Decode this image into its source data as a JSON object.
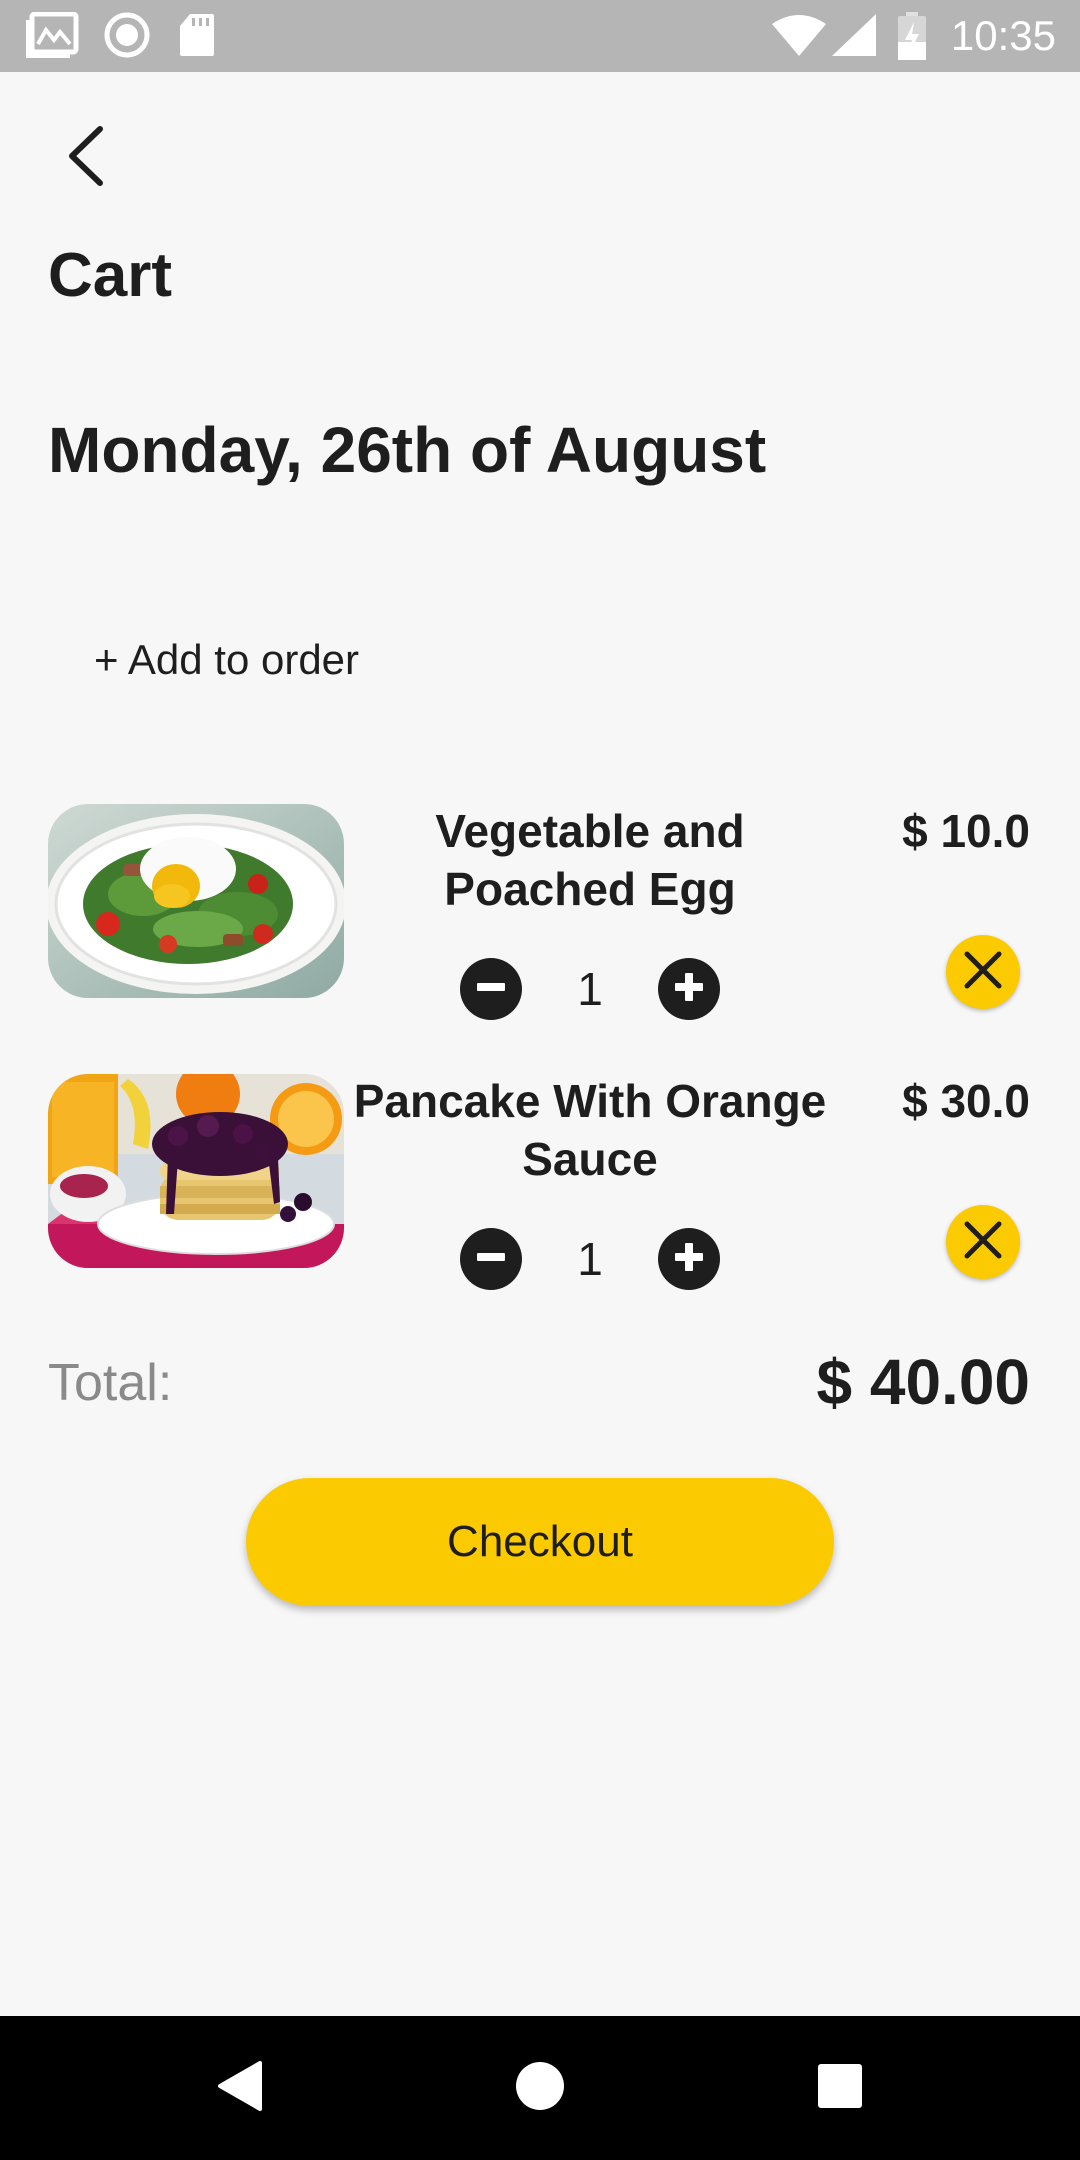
{
  "status_bar": {
    "time": "10:35",
    "icons_left": [
      "gallery-icon",
      "record-icon",
      "sd-card-icon"
    ],
    "icons_right": [
      "wifi-icon",
      "signal-icon",
      "battery-icon"
    ]
  },
  "header": {
    "back_icon": "chevron-left-icon",
    "title": "Cart"
  },
  "date": "Monday, 26th of August",
  "add_to_order_label": "+ Add to order",
  "items": [
    {
      "name": "Vegetable and Poached Egg",
      "price": "$ 10.0",
      "quantity": "1",
      "image": "salad-with-poached-egg"
    },
    {
      "name": "Pancake With Orange Sauce",
      "price": "$ 30.0",
      "quantity": "1",
      "image": "pancakes-with-berry-sauce"
    }
  ],
  "total": {
    "label": "Total:",
    "value": "$ 40.00"
  },
  "checkout_label": "Checkout",
  "colors": {
    "accent": "#fcca00",
    "text": "#1e1e1e",
    "muted": "#8a8a8a",
    "background": "#f7f7f7",
    "status_bar": "#b5b5b5",
    "nav_bar": "#000000"
  }
}
